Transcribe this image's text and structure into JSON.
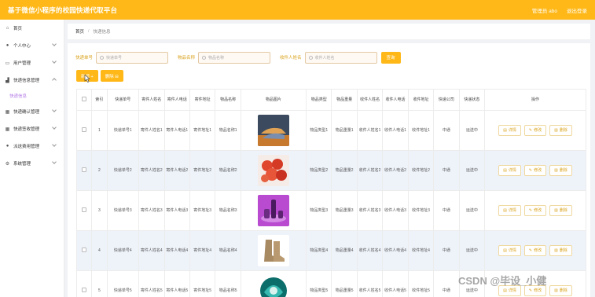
{
  "header": {
    "title": "基于微信小程序的校园快递代取平台",
    "user": "管理员 abo",
    "logout": "退出登录"
  },
  "sidebar": {
    "items": [
      {
        "label": "首页",
        "icon": "home-icon",
        "expandable": false
      },
      {
        "label": "个人中心",
        "icon": "user-icon",
        "expandable": true
      },
      {
        "label": "用户管理",
        "icon": "users-icon",
        "expandable": true
      },
      {
        "label": "快递信息管理",
        "icon": "chart-icon",
        "expandable": true,
        "open": true,
        "children": [
          "快递信息"
        ]
      },
      {
        "label": "快递确认管理",
        "icon": "grid-icon",
        "expandable": true
      },
      {
        "label": "快递签收管理",
        "icon": "grid-icon",
        "expandable": true
      },
      {
        "label": "派送费用管理",
        "icon": "user-icon",
        "expandable": true
      },
      {
        "label": "系统管理",
        "icon": "settings-icon",
        "expandable": true
      }
    ]
  },
  "breadcrumb": {
    "home": "首页",
    "sep": "/",
    "current": "快递信息"
  },
  "search": {
    "fields": [
      {
        "label": "快递单号",
        "placeholder": "快递单号"
      },
      {
        "label": "物品名称",
        "placeholder": "物品名称"
      },
      {
        "label": "收件人姓名",
        "placeholder": "收件人姓名"
      }
    ],
    "button": "查询"
  },
  "toolbar": {
    "add": "新增 +",
    "delete": "删除 ⊟"
  },
  "table": {
    "columns": [
      "",
      "索引",
      "快递单号",
      "寄件人姓名",
      "寄件人电话",
      "寄件地址",
      "物品名称",
      "物品图片",
      "物品类型",
      "物品重量",
      "收件人姓名",
      "收件人电话",
      "收件地址",
      "快递公司",
      "快递状态",
      "操作"
    ],
    "rows": [
      {
        "index": "1",
        "cells": [
          "快递单号1",
          "寄件人姓名1",
          "寄件人电话1",
          "寄件地址1",
          "物品名称1",
          "物品类型1",
          "物品重量1",
          "收件人姓名1",
          "收件人电话1",
          "收件地址1",
          "中通",
          "运送中"
        ],
        "image": "shoes-photo"
      },
      {
        "index": "2",
        "cells": [
          "快递单号2",
          "寄件人姓名2",
          "寄件人电话2",
          "寄件地址2",
          "物品名称2",
          "物品类型2",
          "物品重量2",
          "收件人姓名2",
          "收件人电话2",
          "收件地址2",
          "中通",
          "运送中"
        ],
        "image": "flowers-photo"
      },
      {
        "index": "3",
        "cells": [
          "快递单号3",
          "寄件人姓名3",
          "寄件人电话3",
          "寄件地址3",
          "物品名称3",
          "物品类型3",
          "物品重量3",
          "收件人姓名3",
          "收件人电话3",
          "收件地址3",
          "中通",
          "运送中"
        ],
        "image": "cosmetics-photo"
      },
      {
        "index": "4",
        "cells": [
          "快递单号4",
          "寄件人姓名4",
          "寄件人电话4",
          "寄件地址4",
          "物品名称4",
          "物品类型4",
          "物品重量4",
          "收件人姓名4",
          "收件人电话4",
          "收件地址4",
          "中通",
          "运送中"
        ],
        "image": "boots-photo"
      },
      {
        "index": "5",
        "cells": [
          "快递单号5",
          "寄件人姓名5",
          "寄件人电话5",
          "寄件地址5",
          "物品名称5",
          "物品类型5",
          "物品重量5",
          "收件人姓名5",
          "收件人电话5",
          "收件地址5",
          "中通",
          "运送中"
        ],
        "image": "bag-photo"
      }
    ],
    "ops": {
      "detail": "详情",
      "edit": "修改",
      "delete": "删除"
    }
  },
  "watermark": "CSDN @毕设_小健",
  "colors": {
    "accent": "#ffb818",
    "rowAlt": "#eef3fa",
    "submenu": "#b37ae6"
  }
}
